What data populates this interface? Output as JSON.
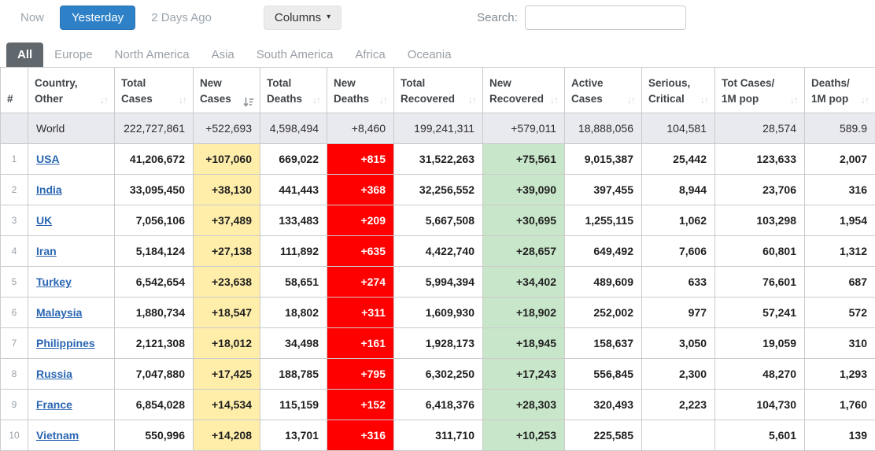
{
  "colors": {
    "accent_blue": "#2e80c7",
    "new_cases_bg": "#ffeeaa",
    "new_deaths_bg": "#ff0000",
    "new_recovered_bg": "#c8e6c9",
    "world_row_bg": "#e9e9f0",
    "link_blue": "#2a66b2",
    "tab_active_bg": "#60686e"
  },
  "toolbar": {
    "now_label": "Now",
    "yesterday_label": "Yesterday",
    "two_days_label": "2 Days Ago",
    "columns_label": "Columns",
    "search_label": "Search:",
    "search_value": "",
    "search_placeholder": ""
  },
  "region_tabs": {
    "all": "All",
    "europe": "Europe",
    "north_america": "North America",
    "asia": "Asia",
    "south_america": "South America",
    "africa": "Africa",
    "oceania": "Oceania"
  },
  "table": {
    "headers": [
      {
        "line1": "#",
        "line2": "",
        "sort": "none"
      },
      {
        "line1": "Country,",
        "line2": "Other",
        "sort": "inactive"
      },
      {
        "line1": "Total",
        "line2": "Cases",
        "sort": "inactive"
      },
      {
        "line1": "New",
        "line2": "Cases",
        "sort": "active_desc"
      },
      {
        "line1": "Total",
        "line2": "Deaths",
        "sort": "inactive"
      },
      {
        "line1": "New",
        "line2": "Deaths",
        "sort": "inactive"
      },
      {
        "line1": "Total",
        "line2": "Recovered",
        "sort": "inactive"
      },
      {
        "line1": "New",
        "line2": "Recovered",
        "sort": "inactive"
      },
      {
        "line1": "Active",
        "line2": "Cases",
        "sort": "inactive"
      },
      {
        "line1": "Serious,",
        "line2": "Critical",
        "sort": "inactive"
      },
      {
        "line1": "Tot Cases/",
        "line2": "1M pop",
        "sort": "inactive"
      },
      {
        "line1": "Deaths/",
        "line2": "1M pop",
        "sort": "inactive"
      }
    ],
    "world": {
      "label": "World",
      "total_cases": "222,727,861",
      "new_cases": "+522,693",
      "total_deaths": "4,598,494",
      "new_deaths": "+8,460",
      "total_recovered": "199,241,311",
      "new_recovered": "+579,011",
      "active_cases": "18,888,056",
      "serious_critical": "104,581",
      "cases_per_1m": "28,574",
      "deaths_per_1m": "589.9"
    },
    "rows": [
      {
        "rank": "1",
        "country": "USA",
        "total_cases": "41,206,672",
        "new_cases": "+107,060",
        "total_deaths": "669,022",
        "new_deaths": "+815",
        "total_recovered": "31,522,263",
        "new_recovered": "+75,561",
        "active_cases": "9,015,387",
        "serious_critical": "25,442",
        "cases_per_1m": "123,633",
        "deaths_per_1m": "2,007"
      },
      {
        "rank": "2",
        "country": "India",
        "total_cases": "33,095,450",
        "new_cases": "+38,130",
        "total_deaths": "441,443",
        "new_deaths": "+368",
        "total_recovered": "32,256,552",
        "new_recovered": "+39,090",
        "active_cases": "397,455",
        "serious_critical": "8,944",
        "cases_per_1m": "23,706",
        "deaths_per_1m": "316"
      },
      {
        "rank": "3",
        "country": "UK",
        "total_cases": "7,056,106",
        "new_cases": "+37,489",
        "total_deaths": "133,483",
        "new_deaths": "+209",
        "total_recovered": "5,667,508",
        "new_recovered": "+30,695",
        "active_cases": "1,255,115",
        "serious_critical": "1,062",
        "cases_per_1m": "103,298",
        "deaths_per_1m": "1,954"
      },
      {
        "rank": "4",
        "country": "Iran",
        "total_cases": "5,184,124",
        "new_cases": "+27,138",
        "total_deaths": "111,892",
        "new_deaths": "+635",
        "total_recovered": "4,422,740",
        "new_recovered": "+28,657",
        "active_cases": "649,492",
        "serious_critical": "7,606",
        "cases_per_1m": "60,801",
        "deaths_per_1m": "1,312"
      },
      {
        "rank": "5",
        "country": "Turkey",
        "total_cases": "6,542,654",
        "new_cases": "+23,638",
        "total_deaths": "58,651",
        "new_deaths": "+274",
        "total_recovered": "5,994,394",
        "new_recovered": "+34,402",
        "active_cases": "489,609",
        "serious_critical": "633",
        "cases_per_1m": "76,601",
        "deaths_per_1m": "687"
      },
      {
        "rank": "6",
        "country": "Malaysia",
        "total_cases": "1,880,734",
        "new_cases": "+18,547",
        "total_deaths": "18,802",
        "new_deaths": "+311",
        "total_recovered": "1,609,930",
        "new_recovered": "+18,902",
        "active_cases": "252,002",
        "serious_critical": "977",
        "cases_per_1m": "57,241",
        "deaths_per_1m": "572"
      },
      {
        "rank": "7",
        "country": "Philippines",
        "total_cases": "2,121,308",
        "new_cases": "+18,012",
        "total_deaths": "34,498",
        "new_deaths": "+161",
        "total_recovered": "1,928,173",
        "new_recovered": "+18,945",
        "active_cases": "158,637",
        "serious_critical": "3,050",
        "cases_per_1m": "19,059",
        "deaths_per_1m": "310"
      },
      {
        "rank": "8",
        "country": "Russia",
        "total_cases": "7,047,880",
        "new_cases": "+17,425",
        "total_deaths": "188,785",
        "new_deaths": "+795",
        "total_recovered": "6,302,250",
        "new_recovered": "+17,243",
        "active_cases": "556,845",
        "serious_critical": "2,300",
        "cases_per_1m": "48,270",
        "deaths_per_1m": "1,293"
      },
      {
        "rank": "9",
        "country": "France",
        "total_cases": "6,854,028",
        "new_cases": "+14,534",
        "total_deaths": "115,159",
        "new_deaths": "+152",
        "total_recovered": "6,418,376",
        "new_recovered": "+28,303",
        "active_cases": "320,493",
        "serious_critical": "2,223",
        "cases_per_1m": "104,730",
        "deaths_per_1m": "1,760"
      },
      {
        "rank": "10",
        "country": "Vietnam",
        "total_cases": "550,996",
        "new_cases": "+14,208",
        "total_deaths": "13,701",
        "new_deaths": "+316",
        "total_recovered": "311,710",
        "new_recovered": "+10,253",
        "active_cases": "225,585",
        "serious_critical": "",
        "cases_per_1m": "5,601",
        "deaths_per_1m": "139"
      }
    ]
  }
}
